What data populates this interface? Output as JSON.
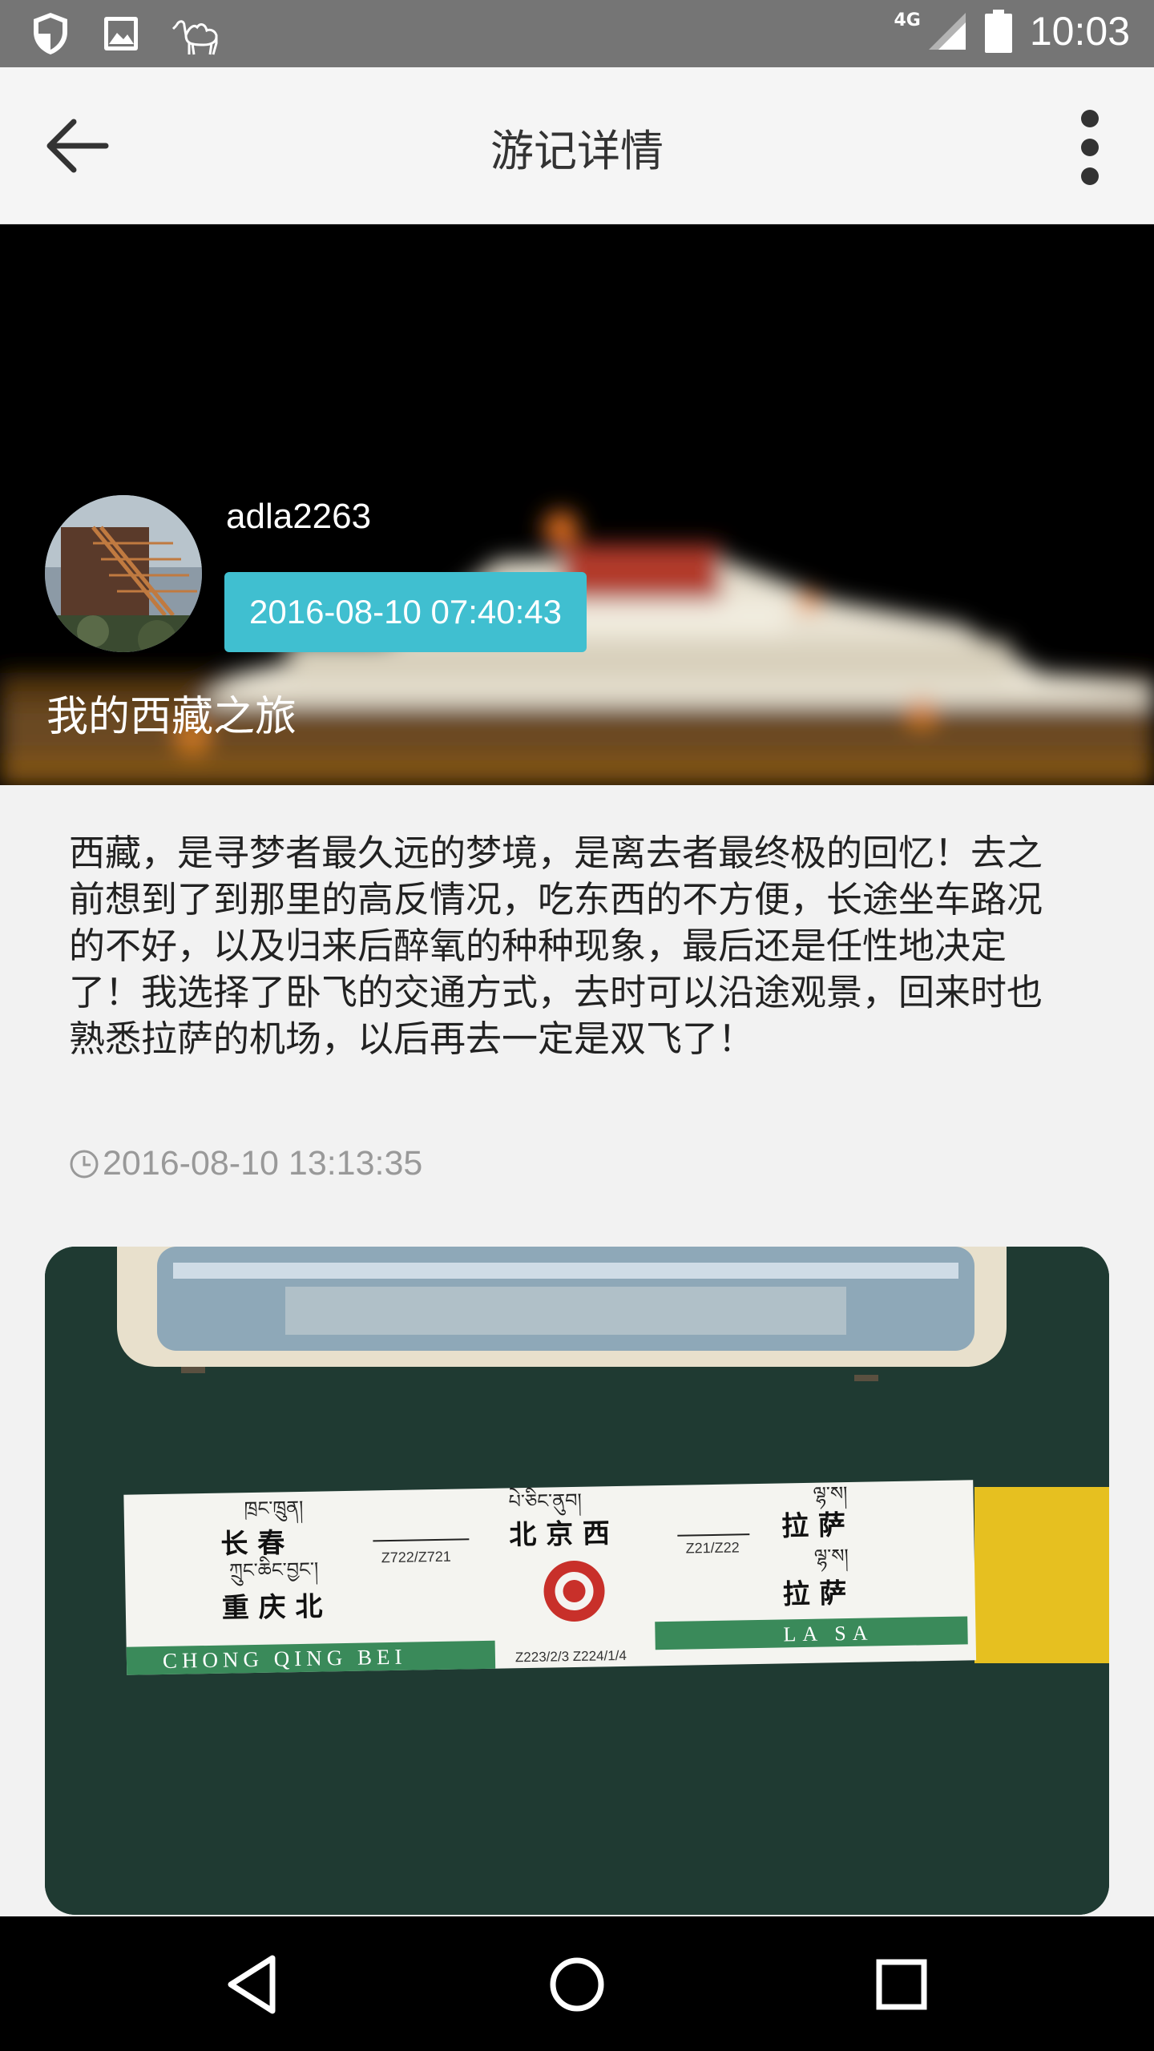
{
  "status_bar": {
    "time": "10:03",
    "network": "4G",
    "icons": [
      "shield-icon",
      "image-icon",
      "camel-icon",
      "signal-icon",
      "battery-icon"
    ]
  },
  "app_bar": {
    "title": "游记详情",
    "back_icon": "arrow-left-icon",
    "more_icon": "more-vertical-icon"
  },
  "header": {
    "username": "adla2263",
    "post_date": "2016-08-10 07:40:43",
    "trip_title": "我的西藏之旅",
    "badge_color": "#40bfd0"
  },
  "entry": {
    "text": "西藏，是寻梦者最久远的梦境，是离去者最终极的回忆！去之前想到了到那里的高反情况，吃东西的不方便，长途坐车路况的不好，以及归来后醉氧的种种现象，最后还是任性地决定了！我选择了卧飞的交通方式，去时可以沿途观景，回来时也熟悉拉萨的机场，以后再去一定是双飞了！",
    "timestamp": "2016-08-10 13:13:35"
  },
  "photo_sign": {
    "tibetan_1": "ཁྲང་ཁྲུན།",
    "tibetan_2": "པེ་ཅིང་ནུབ།",
    "tibetan_3": "ལྷ་ས།",
    "tibetan_4": "ཀྲུང་ཆིང་བྱང་།",
    "tibetan_5": "ལྷ་ས།",
    "city_1": "长 春",
    "route_1": "Z722/Z721",
    "city_2": "北 京 西",
    "route_2": "Z21/Z22",
    "city_3": "拉 萨",
    "city_4": "重 庆 北",
    "city_5": "拉 萨",
    "pinyin_left": "CHONG QING BEI",
    "route_3": "Z223/2/3  Z224/1/4",
    "pinyin_right": "LA  SA"
  },
  "nav_bar": {
    "icons": [
      "back-triangle-icon",
      "home-circle-icon",
      "recents-square-icon"
    ]
  }
}
